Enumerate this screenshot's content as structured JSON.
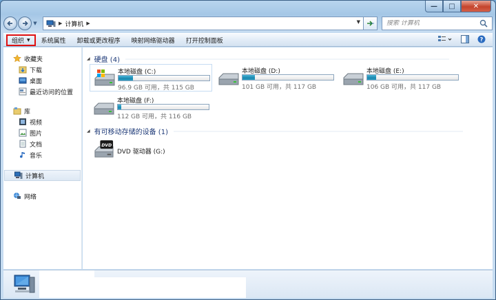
{
  "window": {
    "caption": {
      "min": "—",
      "max": "□",
      "close": "✕"
    }
  },
  "address": {
    "crumb": "计算机",
    "search_placeholder": "搜索 计算机"
  },
  "toolbar": {
    "organize": "组织",
    "system_properties": "系统属性",
    "uninstall": "卸载或更改程序",
    "map_drive": "映射网络驱动器",
    "control_panel": "打开控制面板"
  },
  "nav": {
    "favorites": "收藏夹",
    "downloads": "下载",
    "desktop": "桌面",
    "recent": "最近访问的位置",
    "libraries": "库",
    "videos": "视频",
    "pictures": "图片",
    "documents": "文档",
    "music": "音乐",
    "computer": "计算机",
    "network": "网络"
  },
  "groups": {
    "hard_disks": "硬盘 (4)",
    "removable": "有可移动存储的设备 (1)"
  },
  "drives": [
    {
      "name": "本地磁盘 (C:)",
      "free_text": "96.9 GB 可用，共 115 GB",
      "used_fraction": 0.16
    },
    {
      "name": "本地磁盘 (D:)",
      "free_text": "101 GB 可用，共 117 GB",
      "used_fraction": 0.14
    },
    {
      "name": "本地磁盘 (E:)",
      "free_text": "106 GB 可用，共 117 GB",
      "used_fraction": 0.1
    },
    {
      "name": "本地磁盘 (F:)",
      "free_text": "112 GB 可用，共 116 GB",
      "used_fraction": 0.035
    }
  ],
  "dvd": {
    "name": "DVD 驱动器 (G:)",
    "label": "DVD"
  },
  "colors": {
    "accent_red": "#e01010",
    "group_header": "#1e3a78",
    "bar_fill": "#1b87ae"
  }
}
